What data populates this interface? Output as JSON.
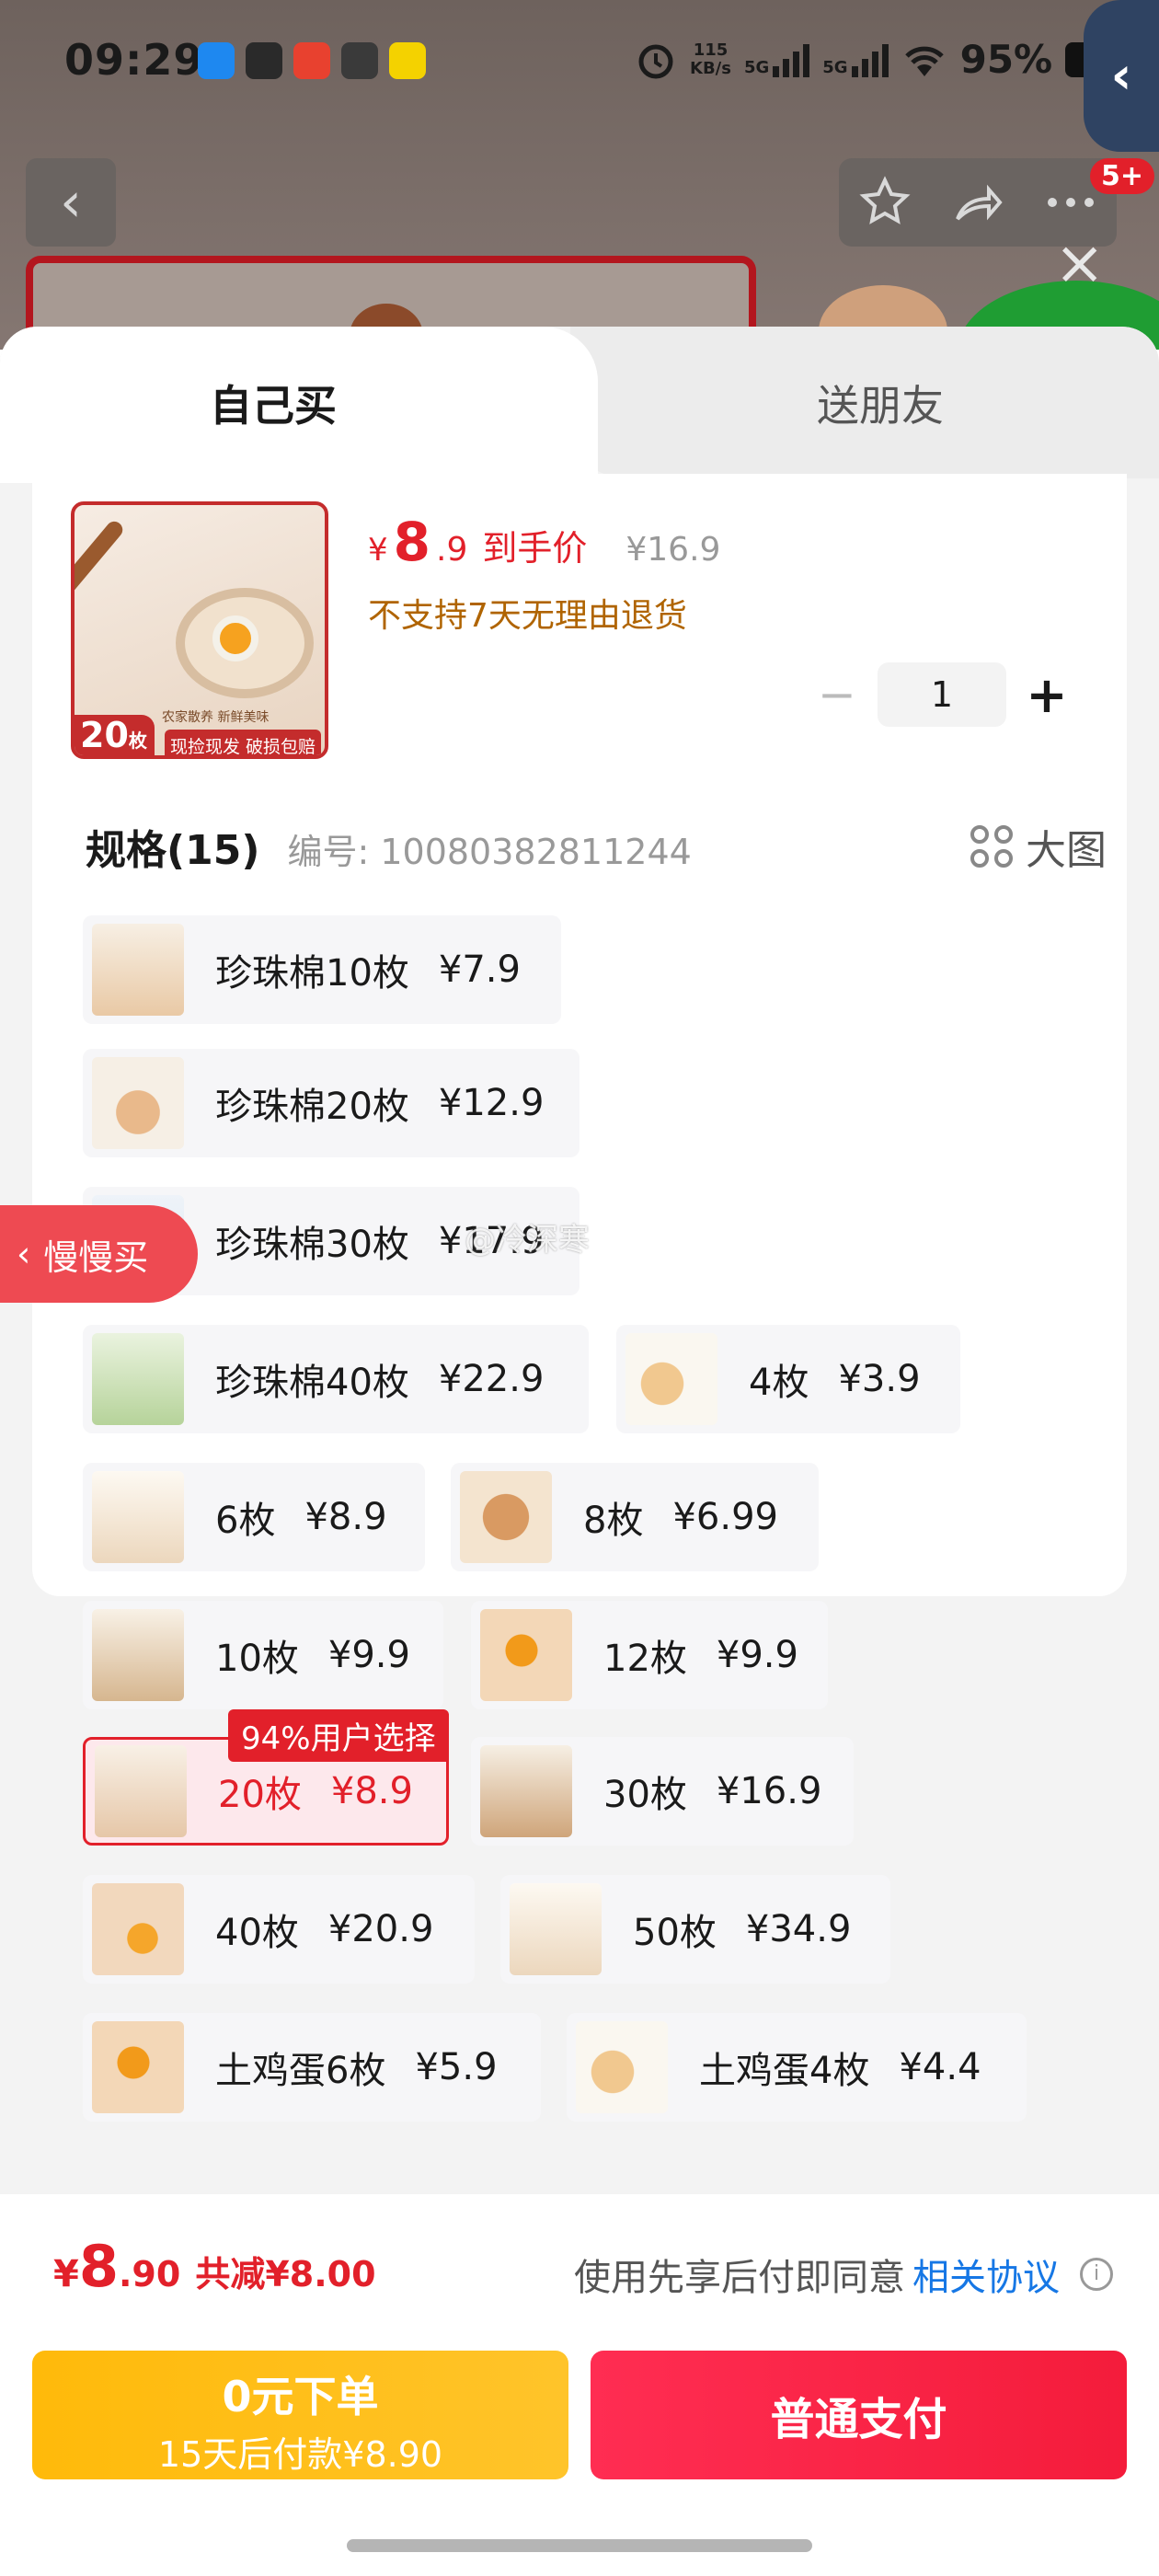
{
  "status_bar": {
    "time": "09:29",
    "net_speed_top": "115",
    "net_speed_unit": "KB/s",
    "sig1": "5G",
    "sig2": "5G",
    "battery": "95%"
  },
  "nav": {
    "back_label": "‹",
    "badge": "5+",
    "side_tab": "‹"
  },
  "tabs": {
    "self_buy": "自己买",
    "gift": "送朋友"
  },
  "product": {
    "thumb_count": "20",
    "thumb_count_unit": "枚",
    "thumb_slogan": "农家散养 新鲜美味",
    "thumb_promo": "现捡现发 破损包赔",
    "price_symbol": "¥",
    "price_int": "8",
    "price_dec": ".9",
    "price_label": "到手价",
    "original_price": "¥16.9",
    "no_return": "不支持7天无理由退货"
  },
  "quantity": {
    "minus": "−",
    "value": "1",
    "plus": "+"
  },
  "specs": {
    "title": "规格(15)",
    "code": "编号: 10080382811244",
    "big_view": "大图"
  },
  "options": [
    {
      "name": "珍珠棉10枚",
      "price": "¥7.9"
    },
    {
      "name": "珍珠棉20枚",
      "price": "¥12.9"
    },
    {
      "name": "珍珠棉30枚",
      "price": "¥17.9"
    },
    {
      "name": "珍珠棉40枚",
      "price": "¥22.9"
    },
    {
      "name": "4枚",
      "price": "¥3.9"
    },
    {
      "name": "6枚",
      "price": "¥8.9"
    },
    {
      "name": "8枚",
      "price": "¥6.99"
    },
    {
      "name": "10枚",
      "price": "¥9.9"
    },
    {
      "name": "12枚",
      "price": "¥9.9"
    },
    {
      "name": "20枚",
      "price": "¥8.9",
      "badge": "94%用户选择"
    },
    {
      "name": "30枚",
      "price": "¥16.9"
    },
    {
      "name": "40枚",
      "price": "¥20.9"
    },
    {
      "name": "50枚",
      "price": "¥34.9"
    },
    {
      "name": "土鸡蛋6枚",
      "price": "¥5.9"
    },
    {
      "name": "土鸡蛋4枚",
      "price": "¥4.4"
    }
  ],
  "float_button": "慢慢买",
  "watermark": "@冷深寒",
  "footer": {
    "yen": "¥",
    "total_int": "8",
    "total_dec": ".90",
    "saved": "共减¥8.00",
    "agree_prefix": "使用先享后付即同意",
    "agree_link": "相关协议",
    "info_icon": "i",
    "btn_later_l1": "0元下单",
    "btn_later_l2": "15天后付款¥8.90",
    "btn_pay": "普通支付"
  },
  "colors": {
    "accent": "#e2202a",
    "pay_button": "#f41c3b",
    "later_button": "#ffba0a",
    "link": "#1677e5",
    "warning_text": "#b06400"
  }
}
